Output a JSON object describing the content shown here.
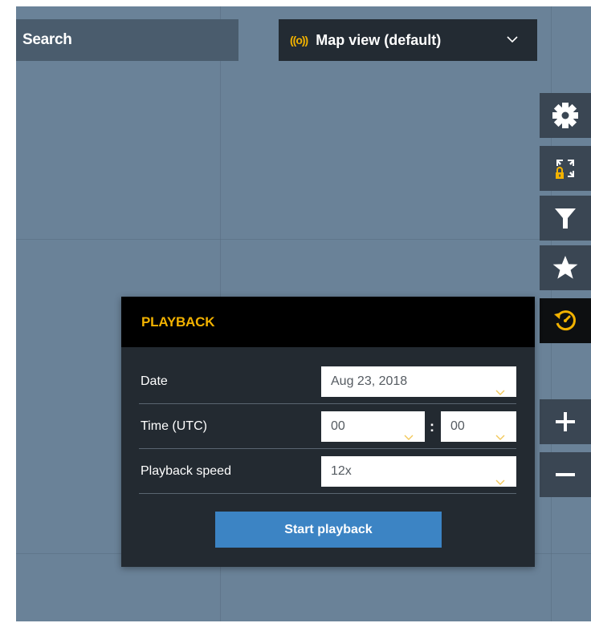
{
  "search": {
    "label": "Search"
  },
  "map_view": {
    "label": "Map view (default)",
    "live_icon": "((o))"
  },
  "toolbar": {
    "items": [
      {
        "icon": "gear-icon"
      },
      {
        "icon": "fullscreen-lock-icon"
      },
      {
        "icon": "filter-icon"
      },
      {
        "icon": "star-icon"
      },
      {
        "icon": "playback-history-icon",
        "active": true
      }
    ],
    "zoom_in": "+",
    "zoom_out": "−"
  },
  "playback": {
    "title": "PLAYBACK",
    "date_label": "Date",
    "date_value": "Aug 23, 2018",
    "time_label": "Time (UTC)",
    "hour_value": "00",
    "minute_value": "00",
    "time_separator": ":",
    "speed_label": "Playback speed",
    "speed_value": "12x",
    "start_label": "Start playback"
  },
  "colors": {
    "accent": "#f2b200",
    "button": "#3c84c4",
    "panel": "#232a31",
    "map": "#6a8298"
  }
}
